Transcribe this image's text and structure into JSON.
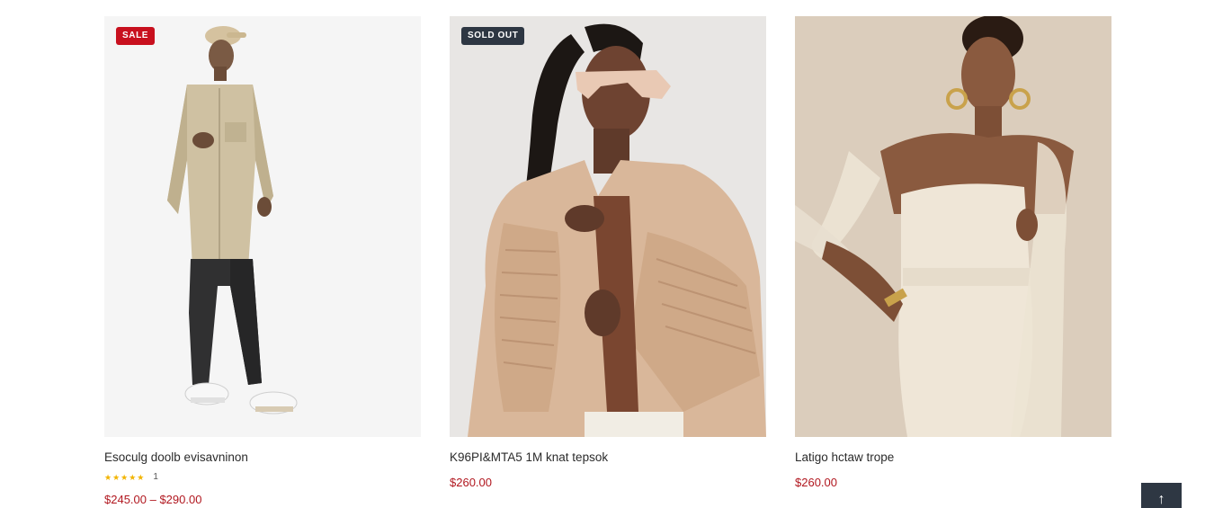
{
  "products": [
    {
      "title": "Esoculg doolb evisavninon",
      "badge": "SALE",
      "stars": "★★★★★",
      "review_count": "1",
      "price": "$245.00 – $290.00",
      "image_icon": "product-photo-man-beige-shirt"
    },
    {
      "title": "K96PI&MTA5 1M knat tepsok",
      "badge": "SOLD OUT",
      "price": "$260.00",
      "image_icon": "product-photo-woman-beige-jacket"
    },
    {
      "title": "Latigo hctaw trope",
      "price": "$260.00",
      "image_icon": "product-photo-woman-cream-dress"
    }
  ],
  "scroll_top": {
    "icon": "arrow-up-icon",
    "glyph": "↑"
  },
  "colors": {
    "sale_badge": "#c8101e",
    "soldout_badge": "#2e3743",
    "price": "#b1171f",
    "stars": "#f2b400",
    "scroll_button": "#2e3743"
  }
}
